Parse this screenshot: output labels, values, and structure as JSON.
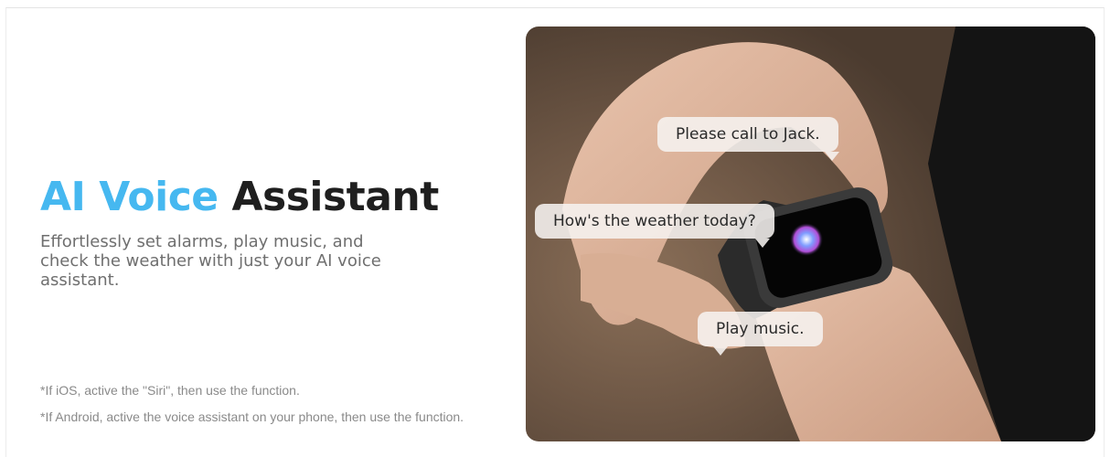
{
  "headline": {
    "accent": "AI Voice",
    "rest": "Assistant"
  },
  "description": "Effortlessly set alarms, play music, and check the weather with just your AI voice assistant.",
  "notes": [
    "*If iOS, active the \"Siri\", then use the function.",
    "*If Android, active the voice assistant on your phone, then use the function."
  ],
  "bubbles": [
    "Please call to Jack.",
    "How's the weather today?",
    "Play music."
  ],
  "colors": {
    "accent": "#46b8f0",
    "heading": "#1f1f1f",
    "text": "#6f6f6f",
    "note": "#8a8a8a"
  }
}
